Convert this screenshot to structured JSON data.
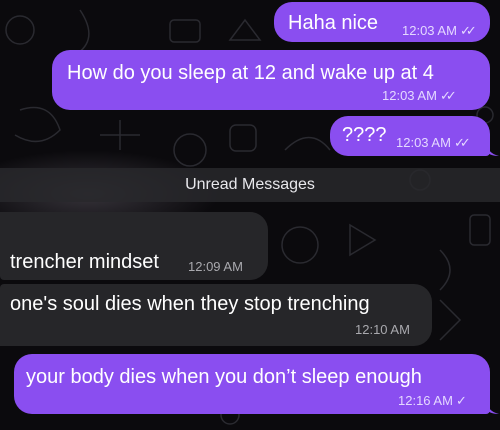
{
  "chat": {
    "unread_label": "Unread Messages",
    "messages": [
      {
        "text": "Haha nice",
        "time": "12:03 AM",
        "ticks": "✓✓"
      },
      {
        "text": "How do you sleep at 12 and wake up at 4",
        "time": "12:03 AM",
        "ticks": "✓✓"
      },
      {
        "text": "????",
        "time": "12:03 AM",
        "ticks": "✓✓"
      },
      {
        "text": "trencher mindset",
        "time": "12:09 AM"
      },
      {
        "text": "one's soul dies when they stop trenching",
        "time": "12:10 AM"
      },
      {
        "text": "your body dies when you don’t sleep enough",
        "time": "12:16 AM",
        "ticks": "✓"
      }
    ]
  },
  "colors": {
    "outgoing_bubble": "#8a4ef0",
    "incoming_bubble": "#262629",
    "background": "#0b0a0d"
  }
}
